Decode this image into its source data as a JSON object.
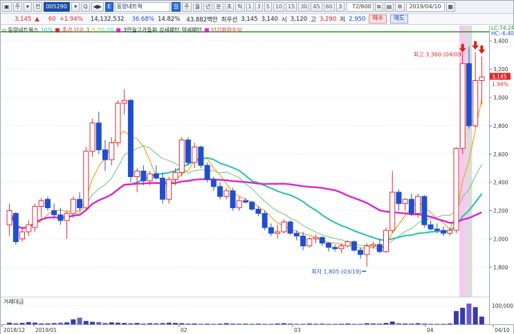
{
  "toolbar": {
    "buttons": [
      "▣",
      "주",
      "▾",
      "전",
      "005290",
      "▾",
      "Q",
      "◀▶",
      "E"
    ],
    "stock_name": "동양네트웍",
    "period_buttons": [
      "일",
      "주",
      "월",
      "년",
      "분",
      "초",
      "틱"
    ],
    "intervals": [
      "1",
      "3",
      "5",
      "10",
      "15",
      "30",
      "45",
      "60"
    ],
    "interval_selected": "3",
    "count_value": "72/600",
    "date_value": "2019/04/10"
  },
  "quote": {
    "price": "3,145",
    "arrow": "▲",
    "change": "60",
    "change_pct": "+1.94%",
    "volume": "14,132,532",
    "ratio1": "36.68%",
    "ratio2": "14.82%",
    "amount": "43.882백만",
    "pref_label": "최우선",
    "bid": "3,145",
    "ask": "3,140",
    "open_label": "시",
    "open": "3,120",
    "high_label": "고",
    "high": "3,290",
    "low_label": "저",
    "low": "2,950",
    "buy_label": "매수",
    "sell_label": "매도"
  },
  "legend": {
    "name": "동양네트웍스",
    "period": "10일",
    "ma_title": "종가 단순",
    "ma_periods": [
      "1",
      "5",
      "10",
      "20"
    ],
    "pattern1": "3연월고가돌파",
    "pattern2": "강세패턴",
    "pattern3": "약세패턴",
    "pattern4": "단기환하수식"
  },
  "colors": {
    "up": "#e0262b",
    "down": "#1f4fd1",
    "ma5": "#f0a020",
    "ma10": "#6fbf6f",
    "ma20": "#2ec4b6",
    "ma60": "#e020d0",
    "lc_line": "#1a9a1a"
  },
  "annotations": {
    "high": "최고 3,360 (04/09)",
    "low": "최저 1,805 (03/19)",
    "lc_label": "LC:74.24",
    "hc_label": "HC:-6.40",
    "current_price": "3,145",
    "current_pct": "1.94%",
    "volume_title": "거래대금"
  },
  "chart_data": {
    "type": "candlestick",
    "y_ticks": [
      "3,400",
      "3,200",
      "3,000",
      "2,800",
      "2,600",
      "2,400",
      "2,200",
      "2,000",
      "1,800"
    ],
    "ylim": [
      1650,
      3450
    ],
    "volume_tick": "100,000",
    "x_labels": [
      "2018/12",
      "2019/01",
      "02",
      "03",
      "04",
      "04/10"
    ],
    "ohlc": [
      [
        2100,
        2250,
        2020,
        2200
      ],
      [
        2180,
        2190,
        1960,
        1980
      ],
      [
        2000,
        2080,
        1980,
        2050
      ],
      [
        2050,
        2130,
        2020,
        2100
      ],
      [
        2080,
        2250,
        2050,
        2230
      ],
      [
        2230,
        2290,
        2150,
        2270
      ],
      [
        2280,
        2300,
        2200,
        2220
      ],
      [
        2200,
        2250,
        2150,
        2170
      ],
      [
        2170,
        2220,
        2100,
        2130
      ],
      [
        2130,
        2200,
        2000,
        2180
      ],
      [
        2180,
        2300,
        2150,
        2280
      ],
      [
        2280,
        2330,
        2200,
        2220
      ],
      [
        2220,
        2650,
        2200,
        2620
      ],
      [
        2620,
        2850,
        2580,
        2820
      ],
      [
        2820,
        2900,
        2600,
        2630
      ],
      [
        2630,
        2700,
        2480,
        2560
      ],
      [
        2560,
        2720,
        2520,
        2680
      ],
      [
        2680,
        2980,
        2650,
        2960
      ],
      [
        2960,
        3060,
        2880,
        2980
      ],
      [
        2980,
        2990,
        2400,
        2440
      ],
      [
        2440,
        2500,
        2330,
        2480
      ],
      [
        2480,
        2520,
        2380,
        2410
      ],
      [
        2410,
        2480,
        2380,
        2460
      ],
      [
        2460,
        2520,
        2420,
        2430
      ],
      [
        2430,
        2470,
        2250,
        2280
      ],
      [
        2280,
        2440,
        2250,
        2420
      ],
      [
        2420,
        2500,
        2380,
        2470
      ],
      [
        2470,
        2720,
        2440,
        2700
      ],
      [
        2700,
        2720,
        2520,
        2540
      ],
      [
        2540,
        2680,
        2500,
        2650
      ],
      [
        2650,
        2660,
        2500,
        2520
      ],
      [
        2520,
        2540,
        2400,
        2420
      ],
      [
        2420,
        2440,
        2340,
        2370
      ],
      [
        2370,
        2400,
        2280,
        2300
      ],
      [
        2300,
        2360,
        2280,
        2340
      ],
      [
        2340,
        2360,
        2200,
        2220
      ],
      [
        2220,
        2300,
        2200,
        2270
      ],
      [
        2270,
        2290,
        2250,
        2260
      ],
      [
        2260,
        2270,
        2200,
        2210
      ],
      [
        2210,
        2230,
        2160,
        2180
      ],
      [
        2180,
        2200,
        2060,
        2080
      ],
      [
        2080,
        2110,
        2020,
        2040
      ],
      [
        2040,
        2100,
        2000,
        2050
      ],
      [
        2050,
        2140,
        2040,
        2120
      ],
      [
        2120,
        2130,
        2030,
        2040
      ],
      [
        2040,
        2060,
        1990,
        2020
      ],
      [
        2020,
        2050,
        1920,
        1950
      ],
      [
        1950,
        2010,
        1940,
        2000
      ],
      [
        2000,
        2030,
        1970,
        2010
      ],
      [
        2010,
        2020,
        1950,
        1970
      ],
      [
        1970,
        1980,
        1910,
        1940
      ],
      [
        1940,
        1960,
        1910,
        1930
      ],
      [
        1930,
        1970,
        1900,
        1950
      ],
      [
        1950,
        1990,
        1940,
        1980
      ],
      [
        1980,
        1990,
        1910,
        1920
      ],
      [
        1920,
        1940,
        1860,
        1890
      ],
      [
        1890,
        1970,
        1805,
        1950
      ],
      [
        1950,
        1980,
        1930,
        1960
      ],
      [
        1960,
        2000,
        1900,
        1910
      ],
      [
        1910,
        2080,
        1900,
        2060
      ],
      [
        2060,
        2480,
        2040,
        2330
      ],
      [
        2330,
        2350,
        2200,
        2250
      ],
      [
        2250,
        2290,
        2200,
        2280
      ],
      [
        2280,
        2320,
        2160,
        2180
      ],
      [
        2180,
        2320,
        2150,
        2300
      ],
      [
        2300,
        2310,
        2080,
        2100
      ],
      [
        2100,
        2130,
        2060,
        2070
      ],
      [
        2070,
        2110,
        2040,
        2060
      ],
      [
        2060,
        2090,
        2020,
        2040
      ],
      [
        2040,
        2080,
        2020,
        2060
      ],
      [
        2060,
        2650,
        2040,
        2640
      ],
      [
        2640,
        3300,
        2600,
        3240
      ],
      [
        3240,
        3360,
        2780,
        2800
      ],
      [
        2800,
        3320,
        2790,
        3120
      ],
      [
        3120,
        3290,
        2950,
        3145
      ]
    ],
    "volume": [
      6,
      4,
      5,
      8,
      6,
      3,
      4,
      5,
      6,
      7,
      18,
      24,
      12,
      9,
      8,
      5,
      7,
      6,
      5,
      4,
      5,
      3,
      4,
      4,
      5,
      6,
      5,
      4,
      3,
      3,
      2,
      3,
      2,
      3,
      4,
      3,
      2,
      3,
      2,
      3,
      2,
      2,
      3,
      4,
      3,
      2,
      2,
      3,
      2,
      3,
      2,
      2,
      2,
      3,
      2,
      2,
      4,
      3,
      3,
      5,
      10,
      4,
      3,
      3,
      4,
      3,
      2,
      2,
      2,
      3,
      48,
      60,
      75,
      62,
      28
    ]
  }
}
